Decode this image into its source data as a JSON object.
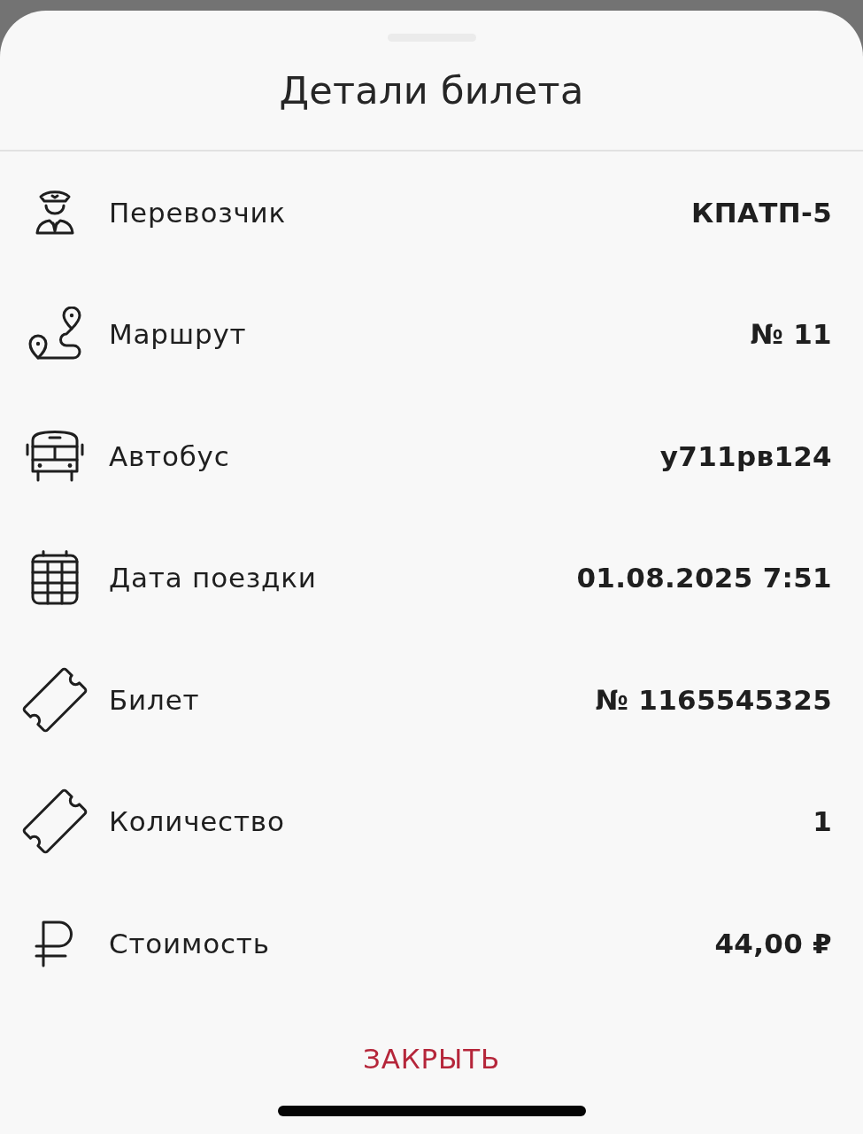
{
  "sheet": {
    "title": "Детали билета"
  },
  "details": [
    {
      "label": "Перевозчик",
      "value": "КПАТП-5"
    },
    {
      "label": "Маршрут",
      "value": "№ 11"
    },
    {
      "label": "Автобус",
      "value": "у711рв124"
    },
    {
      "label": "Дата поездки",
      "value": "01.08.2025 7:51"
    },
    {
      "label": "Билет",
      "value": "№ 1165545325"
    },
    {
      "label": "Количество",
      "value": "1"
    },
    {
      "label": "Стоимость",
      "value": "44,00 ₽"
    }
  ],
  "close_button": {
    "label": "ЗАКРЫТЬ"
  }
}
